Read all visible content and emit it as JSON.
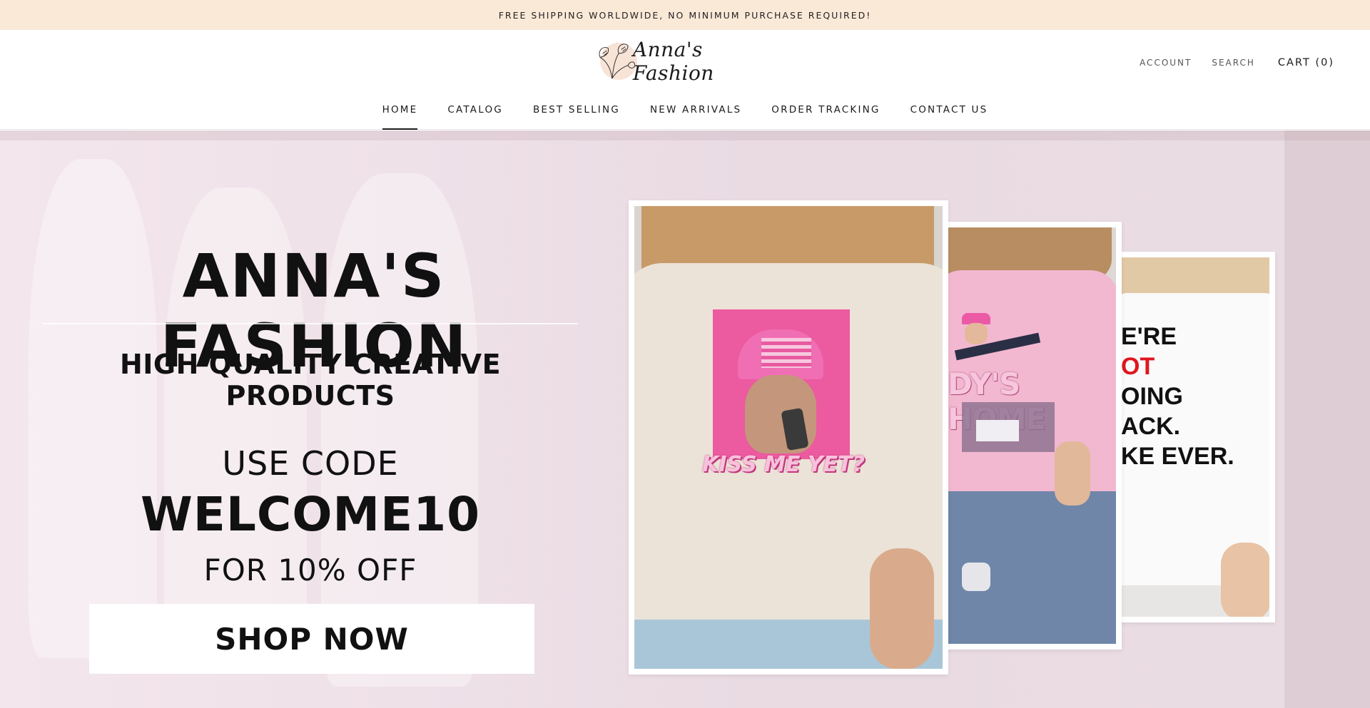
{
  "announcement": "FREE SHIPPING WORLDWIDE, NO MINIMUM PURCHASE REQUIRED!",
  "brand": {
    "name": "Anna's Fashion",
    "logo_icon": "ginkgo-leaf-icon"
  },
  "header": {
    "account": "ACCOUNT",
    "search": "SEARCH",
    "cart": "CART (0)"
  },
  "nav": {
    "items": [
      {
        "label": "HOME",
        "active": true
      },
      {
        "label": "CATALOG"
      },
      {
        "label": "BEST SELLING"
      },
      {
        "label": "NEW ARRIVALS"
      },
      {
        "label": "ORDER TRACKING"
      },
      {
        "label": "CONTACT US"
      }
    ]
  },
  "hero": {
    "title": "ANNA'S FASHION",
    "subtitle": "HIGH QUALITY CREATIVE PRODUCTS",
    "code_intro": "USE CODE",
    "code": "WELCOME10",
    "code_offer": "FOR 10% OFF",
    "cta": "SHOP NOW"
  },
  "products": [
    {
      "shirt_text": "KISS ME YET?"
    },
    {
      "shirt_text": "DY'S HOME"
    },
    {
      "shirt_lines": [
        "E'RE",
        "OT",
        "OING",
        "ACK.",
        "KE EVER."
      ]
    }
  ],
  "colors": {
    "announcement_bg": "#fbe9d8",
    "text": "#1c1b1b",
    "hero_bg": "#efe1e8",
    "shirt_pink": "#f4a6c8",
    "shirt_beige": "#e9e1d4"
  }
}
